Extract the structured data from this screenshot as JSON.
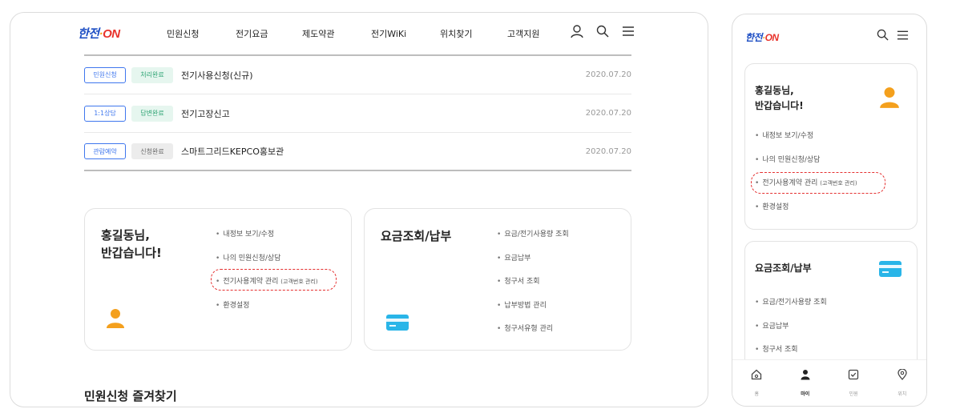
{
  "desktop": {
    "logo": {
      "part1": "한전",
      "dot": "·",
      "part2": "ON"
    },
    "nav": [
      "민원신청",
      "전기요금",
      "제도약관",
      "전기WiKi",
      "위치찾기",
      "고객지원"
    ],
    "requests": [
      {
        "type": "민원신청",
        "status": "처리완료",
        "status_color": "green",
        "title": "전기사용신청(신규)",
        "date": "2020.07.20"
      },
      {
        "type": "1:1상담",
        "status": "답변완료",
        "status_color": "green",
        "title": "전기고장신고",
        "date": "2020.07.20"
      },
      {
        "type": "관람예약",
        "status": "신청완료",
        "status_color": "gray",
        "title": "스마트그리드KEPCO홍보관",
        "date": "2020.07.20"
      }
    ],
    "user_card": {
      "greeting_line1": "홍길동님,",
      "greeting_line2": "반갑습니다!",
      "menu": [
        "내정보 보기/수정",
        "나의 민원신청/상담",
        "전기사용계약 관리",
        "환경설정"
      ],
      "menu_sub": "(고객번호 관리)"
    },
    "fee_card": {
      "title": "요금조회/납부",
      "menu": [
        "요금/전기사용량 조회",
        "요금납부",
        "청구서 조회",
        "납부방법 관리",
        "청구서유형 관리"
      ]
    },
    "section_title": "민원신청 즐겨찾기"
  },
  "mobile": {
    "logo": {
      "part1": "한전",
      "dot": "·",
      "part2": "ON"
    },
    "user_card": {
      "greeting_line1": "홍길동님,",
      "greeting_line2": "반갑습니다!",
      "menu": [
        "내정보 보기/수정",
        "나의 민원신청/상담",
        "전기사용계약 관리",
        "환경설정"
      ],
      "menu_sub": "(고객번호 관리)"
    },
    "fee_card": {
      "title": "요금조회/납부",
      "menu": [
        "요금/전기사용량 조회",
        "요금납부",
        "청구서 조회"
      ]
    },
    "tabs": [
      {
        "label": "홈",
        "icon": "home-icon"
      },
      {
        "label": "마이",
        "icon": "person-icon"
      },
      {
        "label": "민원",
        "icon": "checklist-icon"
      },
      {
        "label": "위치",
        "icon": "location-pin-icon"
      }
    ],
    "active_tab": "마이"
  },
  "colors": {
    "brand_blue": "#1e4fc4",
    "brand_red": "#e8322b",
    "tag_blue": "#3f77ee",
    "status_green": "#2fa474",
    "highlight": "#e53030",
    "card_icon": "#29b5e8",
    "person_icon": "#f4a01d"
  }
}
